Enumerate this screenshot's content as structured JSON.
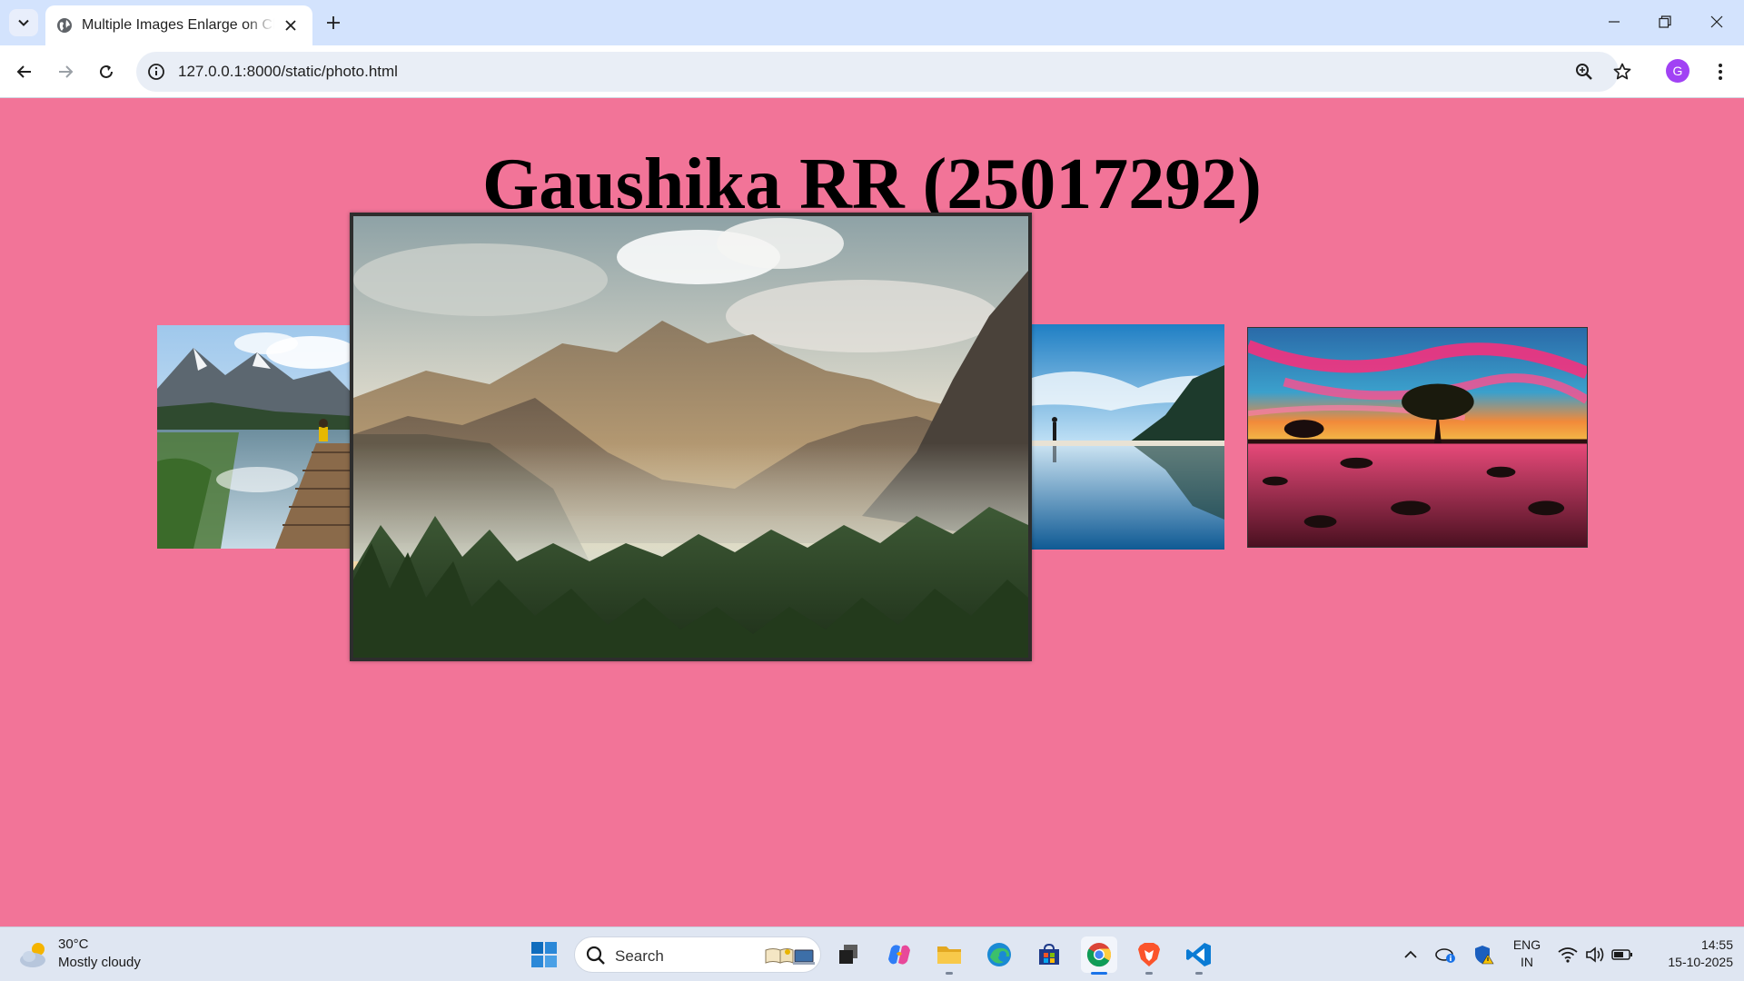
{
  "browser": {
    "tab_title": "Multiple Images Enlarge on Click",
    "url": "127.0.0.1:8000/static/photo.html",
    "profile_initial": "G",
    "accent": "#d3e3fd",
    "profile_color": "#a142f4"
  },
  "page": {
    "title": "Gaushika RR (25017292)",
    "background": "#f27498",
    "images": [
      {
        "subject": "mountain lake with wooden pier",
        "state": "normal"
      },
      {
        "subject": "misty mountains over pine forest",
        "state": "enlarged"
      },
      {
        "subject": "hiker walking on reflective beach",
        "state": "normal"
      },
      {
        "subject": "tree at pink sunset on rocky shore",
        "state": "normal"
      }
    ]
  },
  "taskbar": {
    "weather_temp": "30°C",
    "weather_desc": "Mostly cloudy",
    "search_placeholder": "Search",
    "apps": [
      "task-view-icon",
      "copilot-icon",
      "file-explorer-icon",
      "edge-icon",
      "store-icon",
      "chrome-icon",
      "brave-icon",
      "vscode-icon"
    ],
    "active_app": "chrome-icon",
    "lang_line1": "ENG",
    "lang_line2": "IN",
    "time": "14:55",
    "date": "15-10-2025"
  }
}
